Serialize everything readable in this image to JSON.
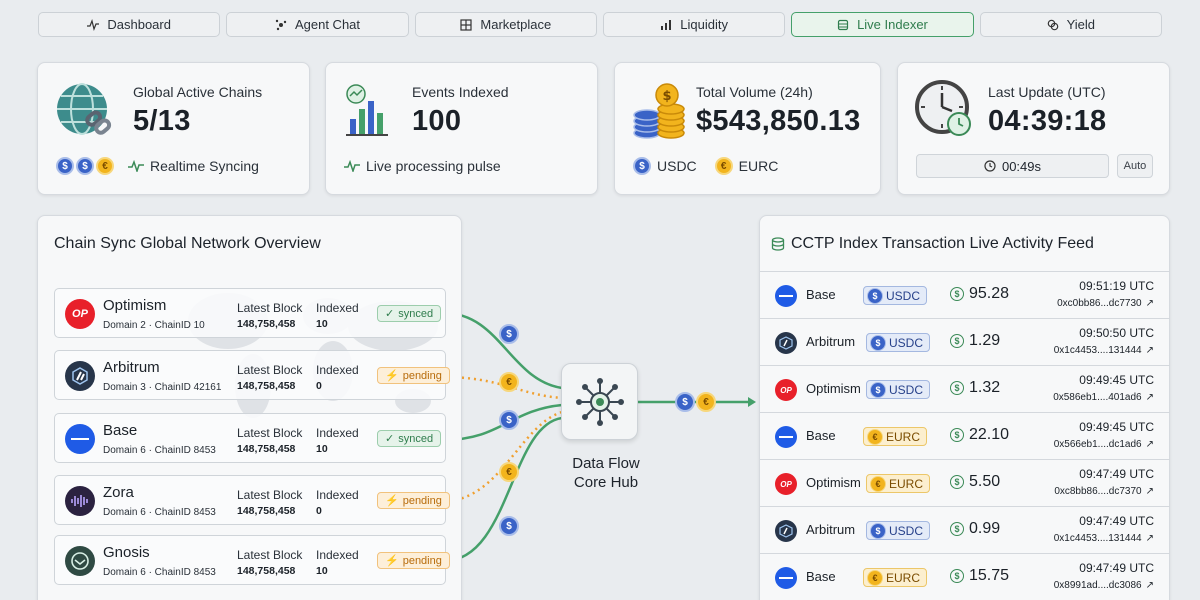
{
  "nav": {
    "tabs": [
      {
        "label": "Dashboard",
        "icon": "activity-icon",
        "active": false
      },
      {
        "label": "Agent Chat",
        "icon": "sparkle-icon",
        "active": false
      },
      {
        "label": "Marketplace",
        "icon": "grid-icon",
        "active": false
      },
      {
        "label": "Liquidity",
        "icon": "bar-chart-icon",
        "active": false
      },
      {
        "label": "Live Indexer",
        "icon": "database-icon",
        "active": true
      },
      {
        "label": "Yield",
        "icon": "coins-icon",
        "active": false
      }
    ]
  },
  "stats": {
    "chains": {
      "label": "Global Active Chains",
      "value": "5/13",
      "sub": "Realtime Syncing"
    },
    "events": {
      "label": "Events Indexed",
      "value": "100",
      "sub": "Live processing pulse"
    },
    "volume": {
      "label": "Total Volume (24h)",
      "value": "$543,850.13",
      "token1": "USDC",
      "token2": "EURC"
    },
    "update": {
      "label": "Last Update (UTC)",
      "value": "04:39:18",
      "timer": "00:49s",
      "auto": "Auto"
    }
  },
  "network": {
    "title": "Chain Sync Global Network Overview",
    "latest_block_label": "Latest Block",
    "indexed_label": "Indexed",
    "chains": [
      {
        "name": "Optimism",
        "domain": "Domain 2 · ChainID 10",
        "block": "148,758,458",
        "indexed": "10",
        "status": "synced",
        "logo_text": "OP",
        "color": "#e8202a"
      },
      {
        "name": "Arbitrum",
        "domain": "Domain 3 · ChainID 42161",
        "block": "148,758,458",
        "indexed": "0",
        "status": "pending",
        "logo_text": "",
        "color": "#27354a"
      },
      {
        "name": "Base",
        "domain": "Domain 6 · ChainID 8453",
        "block": "148,758,458",
        "indexed": "10",
        "status": "synced",
        "logo_text": "",
        "color": "#1f5be6"
      },
      {
        "name": "Zora",
        "domain": "Domain 6 · ChainID 8453",
        "block": "148,758,458",
        "indexed": "0",
        "status": "pending",
        "logo_text": "",
        "color": "#2b2240"
      },
      {
        "name": "Gnosis",
        "domain": "Domain 6 · ChainID 8453",
        "block": "148,758,458",
        "indexed": "10",
        "status": "pending",
        "logo_text": "",
        "color": "#2f4a43"
      }
    ]
  },
  "hub": {
    "label": "Data Flow Core Hub"
  },
  "feed": {
    "title": "CCTP Index Transaction Live Activity Feed",
    "rows": [
      {
        "chain": "Base",
        "token": "USDC",
        "amount": "95.28",
        "time": "09:51:19 UTC",
        "hash": "0xc0bb86...dc7730"
      },
      {
        "chain": "Arbitrum",
        "token": "USDC",
        "amount": "1.29",
        "time": "09:50:50 UTC",
        "hash": "0x1c4453....131444"
      },
      {
        "chain": "Optimism",
        "token": "USDC",
        "amount": "1.32",
        "time": "09:49:45 UTC",
        "hash": "0x586eb1....401ad6"
      },
      {
        "chain": "Base",
        "token": "EURC",
        "amount": "22.10",
        "time": "09:49:45 UTC",
        "hash": "0x566eb1....dc1ad6"
      },
      {
        "chain": "Optimism",
        "token": "EURC",
        "amount": "5.50",
        "time": "09:47:49 UTC",
        "hash": "0xc8bb86....dc7370"
      },
      {
        "chain": "Arbitrum",
        "token": "USDC",
        "amount": "0.99",
        "time": "09:47:49 UTC",
        "hash": "0x1c4453....131444"
      },
      {
        "chain": "Base",
        "token": "EURC",
        "amount": "15.75",
        "time": "09:47:49 UTC",
        "hash": "0x8991ad....dc3086"
      }
    ]
  },
  "colors": {
    "accent": "#45a06a",
    "pending": "#f0a030",
    "usdc": "#3a63c7",
    "eurc": "#f2b41d"
  }
}
